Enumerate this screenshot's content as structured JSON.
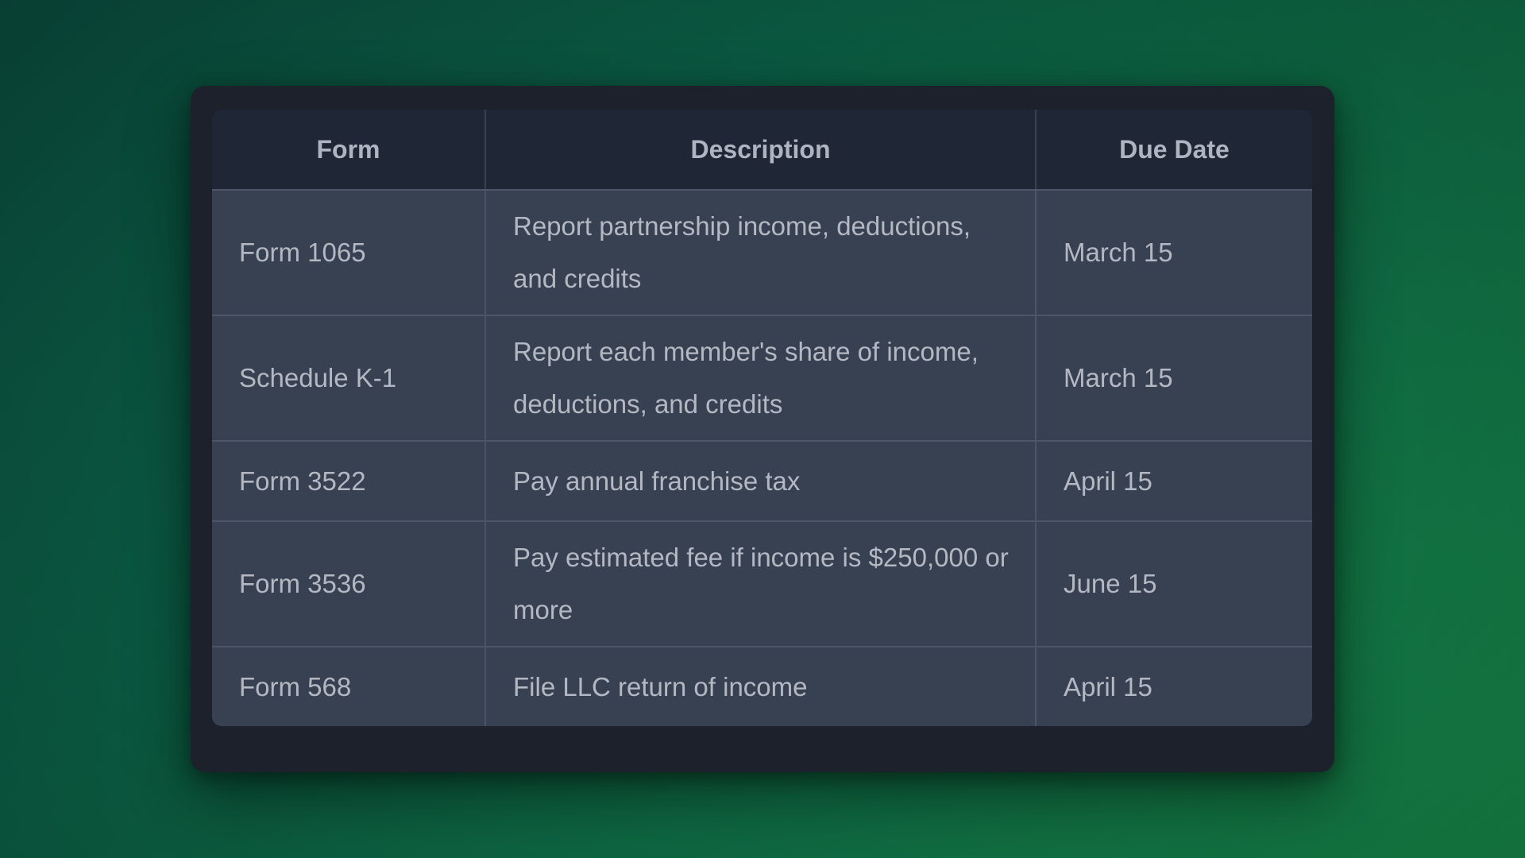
{
  "table": {
    "headers": [
      "Form",
      "Description",
      "Due Date"
    ],
    "rows": [
      {
        "form": "Form 1065",
        "description": "Report partnership income, deductions, and credits",
        "due": "March 15"
      },
      {
        "form": "Schedule K-1",
        "description": "Report each member's share of income, deductions, and credits",
        "due": "March 15"
      },
      {
        "form": "Form 3522",
        "description": "Pay annual franchise tax",
        "due": "April 15"
      },
      {
        "form": "Form 3536",
        "description": "Pay estimated fee if income is $250,000 or more",
        "due": "June 15"
      },
      {
        "form": "Form 568",
        "description": "File LLC return of income",
        "due": "April 15"
      }
    ]
  }
}
